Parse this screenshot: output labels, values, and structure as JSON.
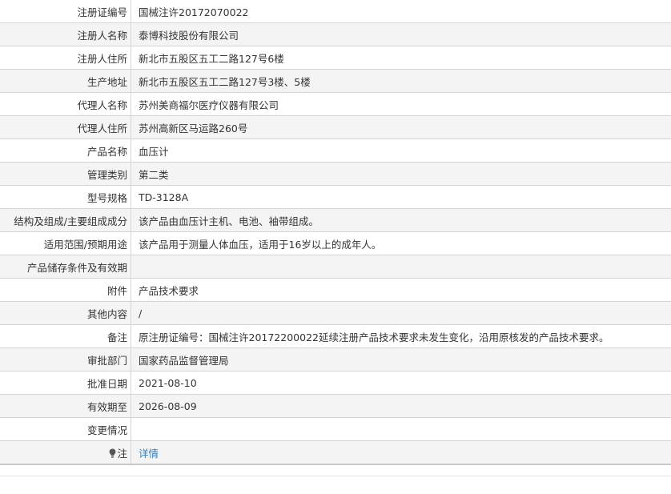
{
  "rows": [
    {
      "label": "注册证编号",
      "value": "国械注许20172070022"
    },
    {
      "label": "注册人名称",
      "value": "泰博科技股份有限公司"
    },
    {
      "label": "注册人住所",
      "value": "新北市五股区五工二路127号6楼"
    },
    {
      "label": "生产地址",
      "value": "新北市五股区五工二路127号3楼、5楼"
    },
    {
      "label": "代理人名称",
      "value": "苏州美商福尔医疗仪器有限公司"
    },
    {
      "label": "代理人住所",
      "value": "苏州高新区马运路260号"
    },
    {
      "label": "产品名称",
      "value": "血压计"
    },
    {
      "label": "管理类别",
      "value": "第二类"
    },
    {
      "label": "型号规格",
      "value": "TD-3128A"
    },
    {
      "label": "结构及组成/主要组成成分",
      "value": "该产品由血压计主机、电池、袖带组成。"
    },
    {
      "label": "适用范围/预期用途",
      "value": "该产品用于测量人体血压，适用于16岁以上的成年人。"
    },
    {
      "label": "产品储存条件及有效期",
      "value": ""
    },
    {
      "label": "附件",
      "value": "产品技术要求"
    },
    {
      "label": "其他内容",
      "value": "/"
    },
    {
      "label": "备注",
      "value": "原注册证编号：国械注许20172200022延续注册产品技术要求未发生变化，沿用原核发的产品技术要求。"
    },
    {
      "label": "审批部门",
      "value": "国家药品监督管理局"
    },
    {
      "label": "批准日期",
      "value": "2021-08-10"
    },
    {
      "label": "有效期至",
      "value": "2026-08-09"
    },
    {
      "label": "变更情况",
      "value": ""
    }
  ],
  "note_row": {
    "icon": "lightbulb-icon",
    "label": "注",
    "link_text": "详情",
    "link_color": "#2f7fc1"
  }
}
